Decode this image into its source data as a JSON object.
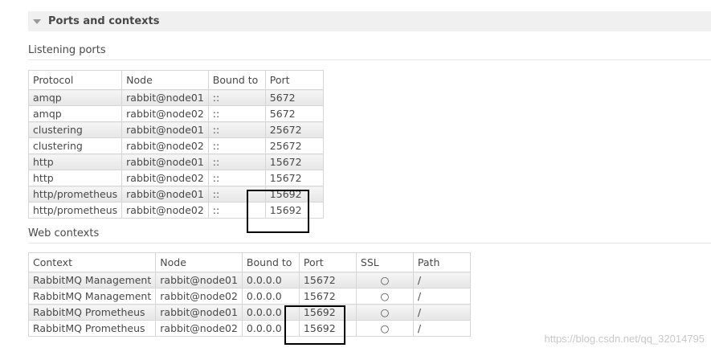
{
  "section": {
    "title": "Ports and contexts"
  },
  "listening": {
    "heading": "Listening ports",
    "columns": [
      "Protocol",
      "Node",
      "Bound to",
      "Port"
    ],
    "rows": [
      [
        "amqp",
        "rabbit@node01",
        "::",
        "5672"
      ],
      [
        "amqp",
        "rabbit@node02",
        "::",
        "5672"
      ],
      [
        "clustering",
        "rabbit@node01",
        "::",
        "25672"
      ],
      [
        "clustering",
        "rabbit@node02",
        "::",
        "25672"
      ],
      [
        "http",
        "rabbit@node01",
        "::",
        "15672"
      ],
      [
        "http",
        "rabbit@node02",
        "::",
        "15672"
      ],
      [
        "http/prometheus",
        "rabbit@node01",
        "::",
        "15692"
      ],
      [
        "http/prometheus",
        "rabbit@node02",
        "::",
        "15692"
      ]
    ]
  },
  "web": {
    "heading": "Web contexts",
    "columns": [
      "Context",
      "Node",
      "Bound to",
      "Port",
      "SSL",
      "Path"
    ],
    "rows": [
      [
        "RabbitMQ Management",
        "rabbit@node01",
        "0.0.0.0",
        "15672",
        "○",
        "/"
      ],
      [
        "RabbitMQ Management",
        "rabbit@node02",
        "0.0.0.0",
        "15672",
        "○",
        "/"
      ],
      [
        "RabbitMQ Prometheus",
        "rabbit@node01",
        "0.0.0.0",
        "15692",
        "○",
        "/"
      ],
      [
        "RabbitMQ Prometheus",
        "rabbit@node02",
        "0.0.0.0",
        "15692",
        "○",
        "/"
      ]
    ]
  },
  "watermark": "https://blog.csdn.net/qq_32014795"
}
